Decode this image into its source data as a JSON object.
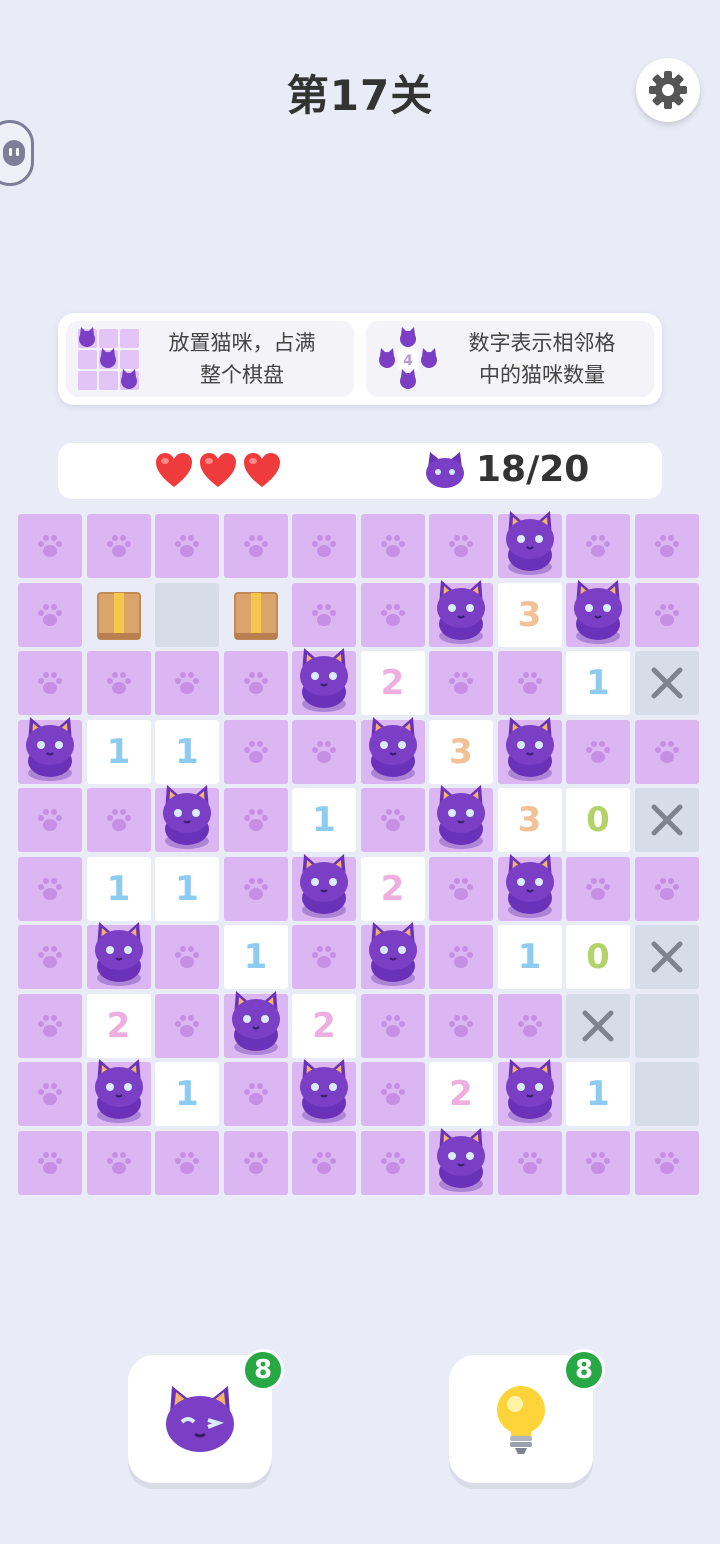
{
  "header": {
    "level_title": "第17关"
  },
  "rules": [
    {
      "text_line1": "放置猫咪，占满",
      "text_line2": "整个棋盘",
      "icon": "mini-board-with-cats-icon"
    },
    {
      "text_line1": "数字表示相邻格",
      "text_line2": "中的猫咪数量",
      "icon": "number-surrounded-by-cats-icon",
      "icon_number": "4"
    }
  ],
  "status": {
    "lives": 3,
    "cats_placed": "18/20"
  },
  "board": {
    "rows": [
      [
        "P",
        "P",
        "P",
        "P",
        "P",
        "P",
        "P",
        "C",
        "P",
        "P"
      ],
      [
        "P",
        "B",
        "E",
        "B",
        "P",
        "P",
        "C",
        "3",
        "C",
        "P"
      ],
      [
        "P",
        "P",
        "P",
        "P",
        "C",
        "2",
        "P",
        "P",
        "1",
        "X"
      ],
      [
        "C",
        "1",
        "1",
        "P",
        "P",
        "C",
        "3",
        "C",
        "P",
        "P"
      ],
      [
        "P",
        "P",
        "C",
        "P",
        "1",
        "P",
        "C",
        "3",
        "0",
        "X"
      ],
      [
        "P",
        "1",
        "1",
        "P",
        "C",
        "2",
        "P",
        "C",
        "P",
        "P"
      ],
      [
        "P",
        "C",
        "P",
        "1",
        "P",
        "C",
        "P",
        "1",
        "0",
        "X"
      ],
      [
        "P",
        "2",
        "P",
        "C",
        "2",
        "P",
        "P",
        "P",
        "X",
        "E"
      ],
      [
        "P",
        "C",
        "1",
        "P",
        "C",
        "P",
        "2",
        "C",
        "1",
        "E"
      ],
      [
        "P",
        "P",
        "P",
        "P",
        "P",
        "P",
        "C",
        "P",
        "P",
        "P"
      ]
    ],
    "legend": {
      "P": "paw-empty",
      "C": "cat",
      "B": "box-obstacle",
      "E": "blocked-empty",
      "X": "marked-x"
    },
    "number_colors": {
      "0": "#b3d26a",
      "1": "#8ecbf0",
      "2": "#efaee0",
      "3": "#f2c196"
    }
  },
  "tools": [
    {
      "name": "cat-hint-button",
      "icon": "winking-cat-icon",
      "count": "8"
    },
    {
      "name": "lightbulb-hint-button",
      "icon": "lightbulb-icon",
      "count": "8"
    }
  ]
}
